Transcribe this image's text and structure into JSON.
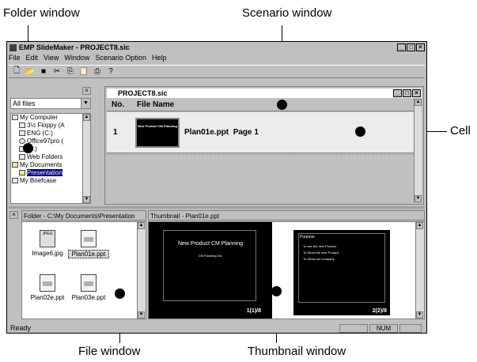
{
  "callouts": {
    "folder_window": "Folder window",
    "scenario_window": "Scenario window",
    "cell": "Cell",
    "file_window": "File window",
    "thumbnail_window": "Thumbnail window"
  },
  "app": {
    "title": "EMP SlideMaker - PROJECT8.sic",
    "menu": [
      "File",
      "Edit",
      "View",
      "Window",
      "Scenario Option",
      "Help"
    ],
    "toolbar_icons": [
      "new-icon",
      "open-icon",
      "save-icon",
      "cut-icon",
      "copy-icon",
      "paste-icon",
      "print-icon",
      "help-icon"
    ]
  },
  "folder_pane": {
    "dropdown_value": "All files",
    "tree": [
      {
        "label": "My Computer",
        "icon": "computer-icon"
      },
      {
        "label": "3½ Floppy (A",
        "icon": "floppy-icon"
      },
      {
        "label": "ENG (C:)",
        "icon": "drive-icon"
      },
      {
        "label": "Office97pro (",
        "icon": "cd-icon"
      },
      {
        "label": "(E:)",
        "icon": "drive-icon"
      },
      {
        "label": "Web Folders",
        "icon": "web-folder-icon"
      },
      {
        "label": "My Documents",
        "icon": "folder-icon"
      },
      {
        "label": "Presentation",
        "icon": "folder-open-icon"
      },
      {
        "label": "My Briefcase",
        "icon": "briefcase-icon"
      }
    ]
  },
  "scenario": {
    "title": "PROJECT8.sic",
    "headers": {
      "no": "No.",
      "file": "File Name"
    },
    "rows": [
      {
        "no": "1",
        "file": "Plan01e.ppt",
        "page": "Page 1"
      }
    ]
  },
  "file_pane": {
    "header": "Folder - C:\\My Documents\\Presentation",
    "files": [
      "Image6.jpg",
      "Plan01e.ppt",
      "Plan02e.ppt",
      "Plan03e.ppt"
    ],
    "selected": "Plan01e.ppt"
  },
  "thumb_pane": {
    "header": "Thumbnail - Plan01e.ppt",
    "slide1": {
      "title": "New Product CM Planning",
      "subtitle": "CM Planning Div.",
      "page": "1(1)/8"
    },
    "slide2": {
      "heading": "Purpose",
      "bullets": [
        "To see the new Product",
        "To Show the new Product",
        "To Show our company"
      ],
      "page": "2(2)/8"
    }
  },
  "status": {
    "text": "Ready",
    "num": "NUM"
  }
}
